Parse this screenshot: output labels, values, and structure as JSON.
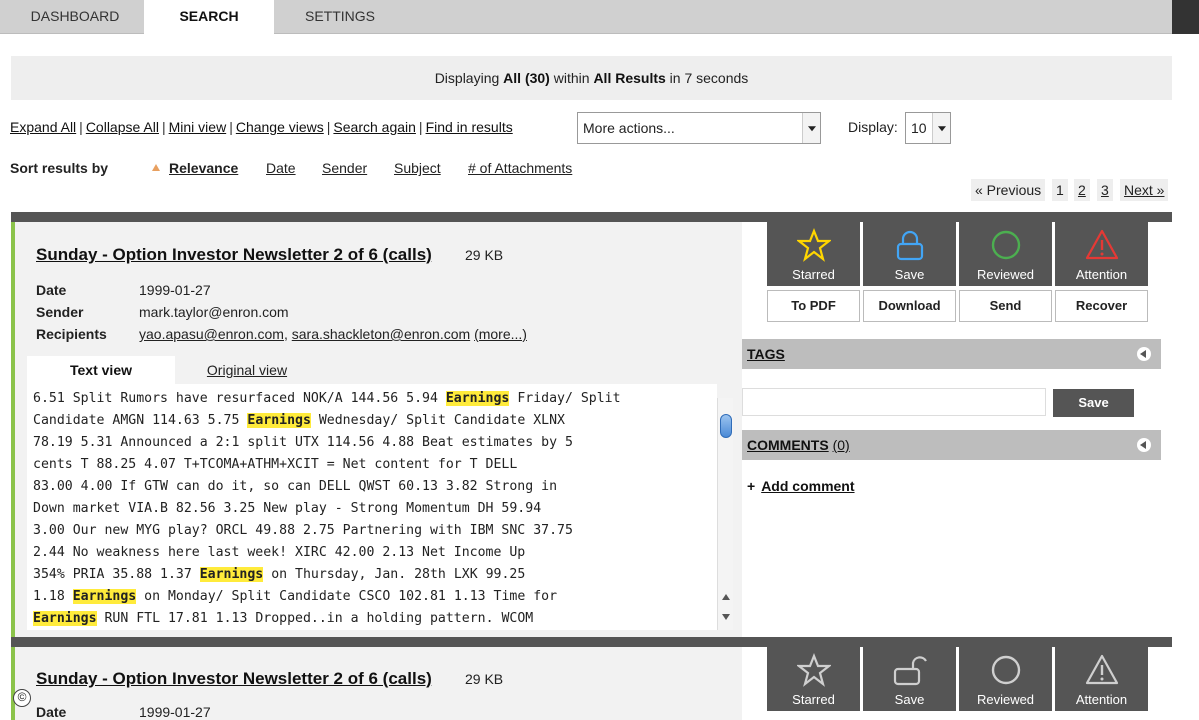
{
  "nav": {
    "tabs": [
      {
        "label": "DASHBOARD"
      },
      {
        "label": "SEARCH"
      },
      {
        "label": "SETTINGS"
      }
    ]
  },
  "status": {
    "prefix": "Displaying ",
    "scope": "All (30)",
    "mid": " within ",
    "collection": "All Results",
    "suffix": " in 7 seconds"
  },
  "toolbar": {
    "links": [
      "Expand All",
      "Collapse All",
      "Mini view",
      "Change views",
      "Search again",
      "Find in results"
    ],
    "more_actions": "More actions...",
    "display_label": "Display:",
    "display_value": "10"
  },
  "sort": {
    "label": "Sort results by",
    "options": [
      "Relevance",
      "Date",
      "Sender",
      "Subject",
      "# of Attachments"
    ]
  },
  "pagination": {
    "previous": "« Previous",
    "pages": [
      "1",
      "2",
      "3"
    ],
    "next": "Next »"
  },
  "results": [
    {
      "title": "Sunday - Option Investor Newsletter 2 of 6 (calls)",
      "size": "29 KB",
      "meta": {
        "date_label": "Date",
        "date": "1999-01-27",
        "sender_label": "Sender",
        "sender": "mark.taylor@enron.com",
        "recipients_label": "Recipients",
        "recipient_1": "yao.apasu@enron.com",
        "recipient_sep": ", ",
        "recipient_2": "sara.shackleton@enron.com",
        "more": "(more...)"
      },
      "view_tabs": {
        "text": "Text view",
        "original": "Original view"
      },
      "body_lines": [
        [
          [
            "6.51 Split Rumors have resurfaced NOK/A 144.56 5.94 ",
            false
          ],
          [
            "Earnings",
            true
          ],
          [
            " Friday/ Split",
            false
          ]
        ],
        [
          [
            "Candidate AMGN 114.63 5.75 ",
            false
          ],
          [
            "Earnings",
            true
          ],
          [
            " Wednesday/ Split Candidate XLNX",
            false
          ]
        ],
        [
          [
            "78.19 5.31 Announced a 2:1 split UTX 114.56 4.88 Beat estimates by 5",
            false
          ]
        ],
        [
          [
            "cents T 88.25 4.07 T+TCOMA+ATHM+XCIT = Net content for T DELL",
            false
          ]
        ],
        [
          [
            "83.00 4.00 If GTW can do it, so can DELL QWST 60.13 3.82 Strong in",
            false
          ]
        ],
        [
          [
            "Down market VIA.B 82.56 3.25 New play - Strong Momentum DH 59.94",
            false
          ]
        ],
        [
          [
            "3.00 Our new MYG play? ORCL 49.88 2.75 Partnering with IBM SNC 37.75",
            false
          ]
        ],
        [
          [
            "2.44 No weakness here last week! XIRC 42.00 2.13 Net Income Up",
            false
          ]
        ],
        [
          [
            "354% PRIA 35.88 1.37 ",
            false
          ],
          [
            "Earnings",
            true
          ],
          [
            " on Thursday, Jan. 28th LXK 99.25",
            false
          ]
        ],
        [
          [
            "1.18 ",
            false
          ],
          [
            "Earnings",
            true
          ],
          [
            " on Monday/ Split Candidate CSCO 102.81 1.13 Time for",
            false
          ]
        ],
        [
          [
            "Earnings",
            true
          ],
          [
            " RUN FTL 17.81 1.13 Dropped..in a holding pattern. WCOM",
            false
          ]
        ]
      ],
      "actions": [
        "Starred",
        "Save",
        "Reviewed",
        "Attention"
      ],
      "secondary_actions": [
        "To PDF",
        "Download",
        "Send",
        "Recover"
      ],
      "tags_label": "TAGS",
      "tags_save": "Save",
      "comments_label": "COMMENTS",
      "comments_count": "(0)",
      "add_comment": "Add comment"
    },
    {
      "title": "Sunday - Option Investor Newsletter 2 of 6 (calls)",
      "size": "29 KB",
      "meta": {
        "date_label": "Date",
        "date": "1999-01-27"
      },
      "actions": [
        "Starred",
        "Save",
        "Reviewed",
        "Attention"
      ]
    }
  ],
  "footer": {
    "copyright_symbol": "©"
  },
  "colors": {
    "accent_orange": "#f08a2a",
    "highlight": "#ffeb3b",
    "action_bg": "#555555",
    "attention_red": "#e53935",
    "reviewed_green": "#4caf50",
    "save_blue": "#42a5f5",
    "star_yellow": "#ffd600"
  }
}
